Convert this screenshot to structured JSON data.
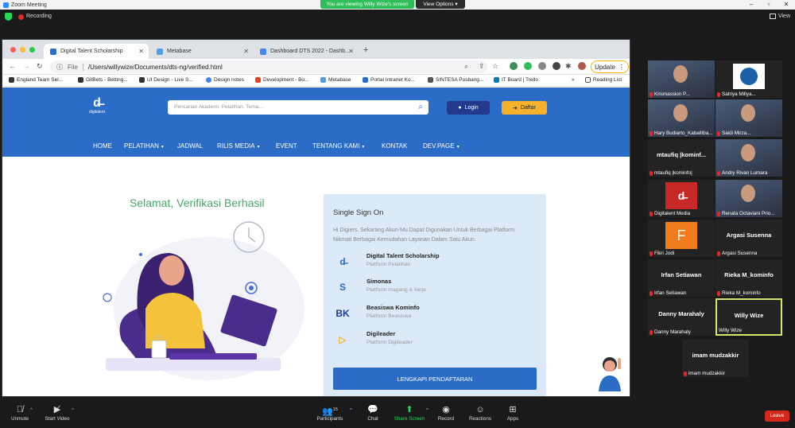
{
  "zoom": {
    "window_title": "Zoom Meeting",
    "recording_label": "Recording",
    "viewing_banner": "You are viewing Willy Wize's screen",
    "view_options": "View Options",
    "view_label": "View"
  },
  "browser": {
    "tabs": [
      {
        "title": "Digital Talent Scholarship",
        "active": true
      },
      {
        "title": "Metabase",
        "active": false
      },
      {
        "title": "Dashboard DTS 2022 - Dashb...",
        "active": false
      }
    ],
    "address_prefix": "File",
    "address": "/Users/willywize/Documents/dts-ng/verified.html",
    "update_label": "Update",
    "bookmarks": [
      "England Team Sel...",
      "GitBets - Betting...",
      "UI Design - Live S...",
      "Design notes",
      "Development - Bo...",
      "Metabase",
      "Portal Intranet Ko...",
      "SINTESA Pusbang...",
      "IT Board | Trello"
    ],
    "reading_list": "Reading List",
    "more_bookmarks": "»"
  },
  "site": {
    "logo_text": "digitalent",
    "search_placeholder": "Pencarian Akademi, Pelatihan, Tema...",
    "login": "Login",
    "daftar": "Daftar",
    "nav": [
      "HOME",
      "PELATIHAN",
      "JADWAL",
      "RILIS MEDIA",
      "EVENT",
      "TENTANG KAMI",
      "KONTAK",
      "DEV.PAGE"
    ],
    "hero_title": "Selamat, Verifikasi Berhasil",
    "sso": {
      "title": "Single Sign On",
      "description": "Hi Digiers, Sekarang Akun-Mu Dapat Digunakan Untuk Berbagai Platform. Nikmati Berbagai Kemudahan Layanan Dalam Satu Akun.",
      "items": [
        {
          "name": "Digital Talent Scholarship",
          "sub": "Platform Pelatihan",
          "icon": "digitalent-icon"
        },
        {
          "name": "Simonas",
          "sub": "Platform magang & kerja",
          "icon": "simonas-icon"
        },
        {
          "name": "Beasiswa Kominfo",
          "sub": "Platform Beasiswa",
          "icon": "beasiswa-icon"
        },
        {
          "name": "Digileader",
          "sub": "Platform Digileader",
          "icon": "digileader-icon"
        }
      ],
      "cta": "LENGKAPI PENDAFTARAN"
    }
  },
  "participants": [
    {
      "name": "Krismassion P...",
      "kind": "video"
    },
    {
      "name": "Satriya Millya...",
      "kind": "logo"
    },
    {
      "name": "Hary Budiarto_Kabalitba...",
      "kind": "video"
    },
    {
      "name": "Saidi Mirza...",
      "kind": "video"
    },
    {
      "name": "mtaufiq |kominfo|",
      "big": "mtaufiq  |kominf...",
      "kind": "name"
    },
    {
      "name": "Andry Rivan Lumara",
      "kind": "video"
    },
    {
      "name": "Digitalent Media",
      "kind": "logo-red"
    },
    {
      "name": "Renata Octaviani Prio...",
      "kind": "video"
    },
    {
      "name": "Fikri Jodi",
      "kind": "letter",
      "letter": "F"
    },
    {
      "name": "Argasi Susenna",
      "big": "Argasi Susenna",
      "kind": "name"
    },
    {
      "name": "Irfan Setiawan",
      "big": "Irfan Setiawan",
      "kind": "name"
    },
    {
      "name": "Rieka M_kominfo",
      "big": "Rieka M_kominfo",
      "kind": "name"
    },
    {
      "name": "Danny Marahaly",
      "big": "Danny Marahaly",
      "kind": "name"
    },
    {
      "name": "Willy Wize",
      "big": "Willy Wize",
      "kind": "name",
      "active": true
    },
    {
      "name": "imam mudzakkir",
      "big": "imam mudzakkir",
      "kind": "name"
    }
  ],
  "toolbar": {
    "unmute": "Unmute",
    "start_video": "Start Video",
    "participants": "Participants",
    "participants_count": "15",
    "chat": "Chat",
    "share_screen": "Share Screen",
    "record": "Record",
    "reactions": "Reactions",
    "apps": "Apps",
    "leave": "Leave"
  },
  "colors": {
    "zoom_green": "#2fbd5a",
    "site_blue": "#2a6cc6",
    "hero_green": "#4aa56e",
    "login_navy": "#233a8c",
    "daftar_yellow": "#f6b12c",
    "leave_red": "#d3291c"
  }
}
